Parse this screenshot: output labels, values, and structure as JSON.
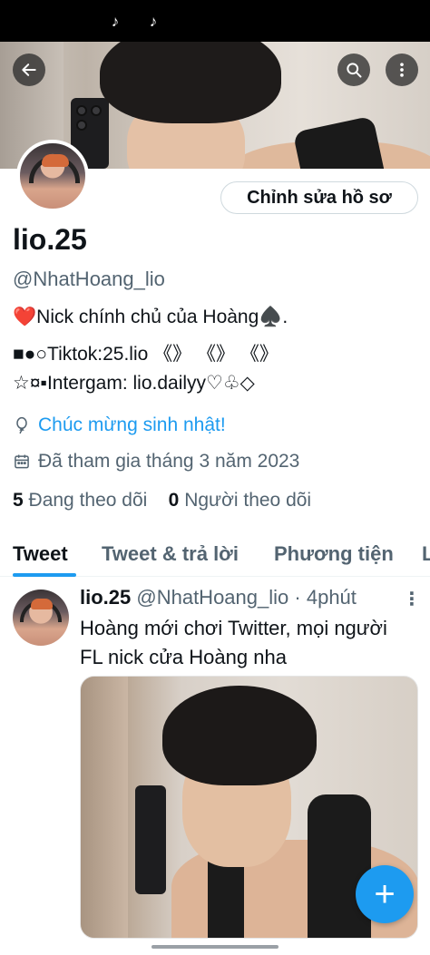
{
  "status_bar": {
    "icons": [
      "tiktok-icon",
      "tiktok-icon"
    ]
  },
  "header": {
    "back_icon": "arrow-left-icon",
    "search_icon": "search-icon",
    "more_icon": "more-vertical-icon"
  },
  "profile": {
    "edit_button": "Chỉnh sửa hồ sơ",
    "name": "lio.25",
    "handle": "@NhatHoang_lio",
    "bio": [
      "❤️Nick chính chủ của Hoàng♠️.",
      "■●○Tiktok:25.lio 《》 《》 《》",
      "☆¤▪Intergam: lio.dailyy♡♧◇"
    ],
    "birthday_icon": "balloon-icon",
    "birthday": "Chúc mừng sinh nhật!",
    "joined_icon": "calendar-icon",
    "joined": "Đã tham gia tháng 3 năm 2023",
    "following_count": "5",
    "following_label": "Đang theo dõi",
    "followers_count": "0",
    "followers_label": "Người theo dõi"
  },
  "tabs": [
    {
      "label": "Tweet",
      "active": true
    },
    {
      "label": "Tweet & trả lời",
      "active": false
    },
    {
      "label": "Phương tiện",
      "active": false
    },
    {
      "label": "L",
      "active": false
    }
  ],
  "tweet": {
    "name": "lio.25",
    "handle": "@NhatHoang_lio",
    "separator": "·",
    "time": "4phút",
    "more": "⋮",
    "text_lines": [
      "Hoàng mới chơi Twitter, mọi người",
      "FL nick cửa Hoàng nha"
    ]
  },
  "fab": {
    "icon": "plus-icon",
    "label": "+"
  },
  "colors": {
    "accent": "#1d9bf0",
    "text": "#0f1419",
    "secondary": "#536471"
  }
}
